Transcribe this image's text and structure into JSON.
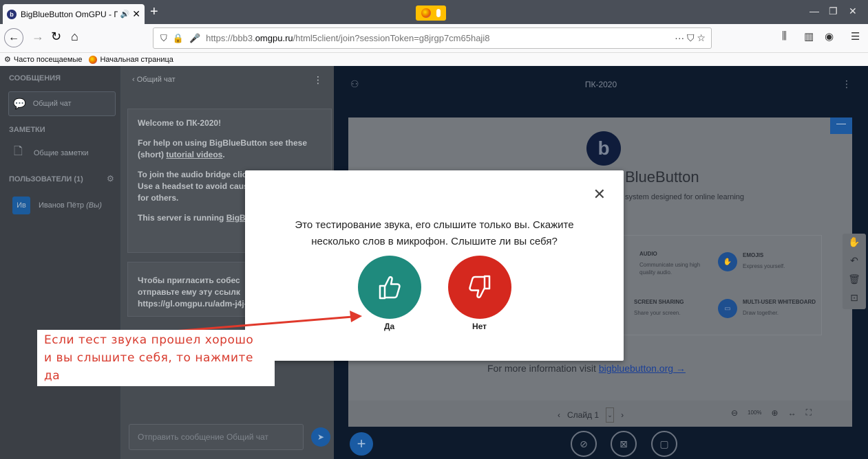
{
  "browser": {
    "tab_title": "BigBlueButton OmGPU - ПК",
    "tab_favicon": "b",
    "tab_audio_icon": "speaker-icon",
    "new_tab": "+",
    "url_prefix": "https://bbb3.",
    "url_domain": "omgpu.ru",
    "url_suffix": "/html5client/join?sessionToken=g8jrgp7cm65haji8",
    "url_actions": "··· ⛉ ☆",
    "bookmarks": [
      "Часто посещаемые",
      "Начальная страница"
    ]
  },
  "sidebar": {
    "messages_heading": "СООБЩЕНИЯ",
    "public_chat": "Общий чат",
    "notes_heading": "ЗАМЕТКИ",
    "shared_notes": "Общие заметки",
    "users_heading": "ПОЛЬЗОВАТЕЛИ (1)",
    "user_avatar": "Ив",
    "user_name": "Иванов Пётр",
    "user_you": "(Вы)"
  },
  "chat": {
    "header": "‹  Общий чат",
    "welcome_title": "Welcome to ПК-2020!",
    "welcome_help_pre": "For help on using BigBlueButton see these (short) ",
    "welcome_help_link": "tutorial videos",
    "welcome_help_post": ".",
    "welcome_audio": "To join the audio bridge click",
    "welcome_headset": "Use a headset to avoid causin",
    "welcome_others": "for others.",
    "welcome_server_pre": "This server is running ",
    "welcome_server_link": "BigBlu",
    "invite_line1": "Чтобы пригласить собес",
    "invite_line2": "отправьте ему эту ссылк",
    "invite_link": "https://gl.omgpu.ru/adm-j4j-",
    "input_placeholder": "Отправить сообщение Общий чат"
  },
  "presentation": {
    "meeting_title": "ПК-2020",
    "slide_title": "BlueButton",
    "slide_subtitle": "system designed for online learning",
    "features": [
      {
        "title": "AUDIO",
        "desc": "Communicate using high quality audio."
      },
      {
        "title": "EMOJIS",
        "desc": "Express yourself."
      },
      {
        "title": "SCREEN SHARING",
        "desc": "Share your screen."
      },
      {
        "title": "MULTI-USER WHITEBOARD",
        "desc": "Draw together."
      }
    ],
    "more_info_text": "For more information visit ",
    "more_info_link": "bigbluebutton.org →",
    "slide_label": "Слайд 1",
    "zoom": "100%"
  },
  "modal": {
    "line1": "Это тестирование звука, его слышите только вы. Скажите",
    "line2": "несколько слов в микрофон. Слышите ли вы себя?",
    "yes_label": "Да",
    "no_label": "Нет"
  },
  "annotation": {
    "line1": "Если тест звука прошел хорошо",
    "line2": "и вы слышите себя, то нажмите да"
  },
  "colors": {
    "yes": "#1f8a7d",
    "no": "#d5281e",
    "annotation_text": "#d83b2e",
    "bbb_blue": "#1a5ba3"
  }
}
